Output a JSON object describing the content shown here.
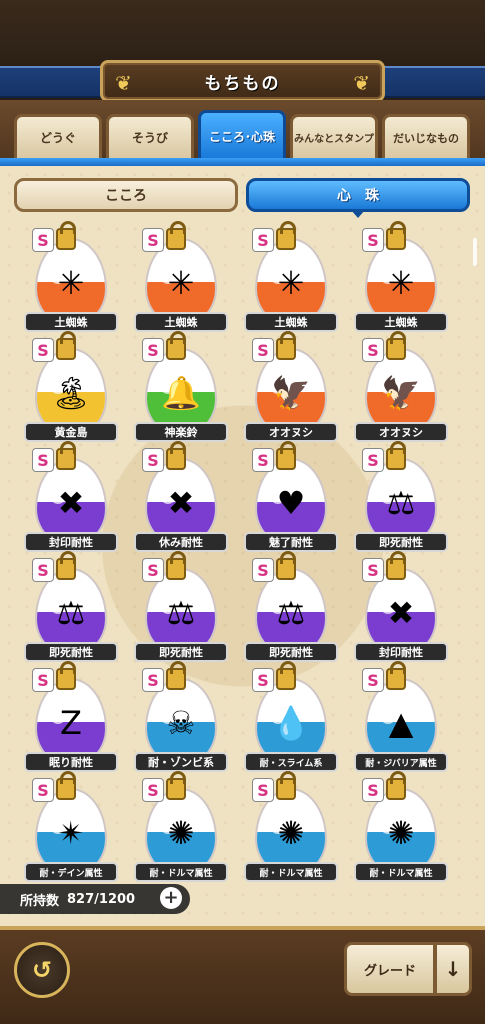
{
  "header": {
    "title": "もちもの"
  },
  "tabs": [
    {
      "label": "どうぐ",
      "active": false
    },
    {
      "label": "そうび",
      "active": false
    },
    {
      "label": "こころ･心珠",
      "active": true
    },
    {
      "label": "みんなとスタンプ",
      "active": false
    },
    {
      "label": "だいじなもの",
      "active": false
    }
  ],
  "segment": {
    "left": "こころ",
    "right": "心　珠"
  },
  "items": [
    {
      "label": "土蜘蛛",
      "color": "#f06a2a",
      "icon": "spider-web-icon",
      "glyph": "✳"
    },
    {
      "label": "土蜘蛛",
      "color": "#f06a2a",
      "icon": "spider-web-icon",
      "glyph": "✳"
    },
    {
      "label": "土蜘蛛",
      "color": "#f06a2a",
      "icon": "spider-web-icon",
      "glyph": "✳"
    },
    {
      "label": "土蜘蛛",
      "color": "#f06a2a",
      "icon": "spider-web-icon",
      "glyph": "✳"
    },
    {
      "label": "黄金島",
      "color": "#f2c230",
      "icon": "casino-island-icon",
      "glyph": "🏝"
    },
    {
      "label": "神楽鈴",
      "color": "#4fbf3a",
      "icon": "bell-icon",
      "glyph": "🔔"
    },
    {
      "label": "オオヌシ",
      "color": "#f06a2a",
      "icon": "eagle-icon",
      "glyph": "🦅"
    },
    {
      "label": "オオヌシ",
      "color": "#f06a2a",
      "icon": "eagle-icon",
      "glyph": "🦅"
    },
    {
      "label": "封印耐性",
      "color": "#7a3dcf",
      "icon": "seal-face-icon",
      "glyph": "✖"
    },
    {
      "label": "休み耐性",
      "color": "#7a3dcf",
      "icon": "red-cross-icon",
      "glyph": "✖"
    },
    {
      "label": "魅了耐性",
      "color": "#7a3dcf",
      "icon": "hearts-icon",
      "glyph": "♥"
    },
    {
      "label": "即死耐性",
      "color": "#7a3dcf",
      "icon": "death-glyph-icon",
      "glyph": "⚖"
    },
    {
      "label": "即死耐性",
      "color": "#7a3dcf",
      "icon": "death-glyph-icon",
      "glyph": "⚖"
    },
    {
      "label": "即死耐性",
      "color": "#7a3dcf",
      "icon": "death-glyph-icon",
      "glyph": "⚖"
    },
    {
      "label": "即死耐性",
      "color": "#7a3dcf",
      "icon": "death-glyph-icon",
      "glyph": "⚖"
    },
    {
      "label": "封印耐性",
      "color": "#7a3dcf",
      "icon": "seal-face-icon",
      "glyph": "✖"
    },
    {
      "label": "眠り耐性",
      "color": "#7a3dcf",
      "icon": "sleep-zzz-icon",
      "glyph": "Z"
    },
    {
      "label": "耐・ゾンビ系",
      "color": "#2d9bd6",
      "icon": "skull-icon",
      "glyph": "☠"
    },
    {
      "label": "耐・スライム系",
      "color": "#2d9bd6",
      "icon": "slime-icon",
      "glyph": "💧"
    },
    {
      "label": "耐・ジバリア属性",
      "color": "#2d9bd6",
      "icon": "rock-spikes-icon",
      "glyph": "▲"
    },
    {
      "label": "耐・デイン属性",
      "color": "#2d9bd6",
      "icon": "lightning-star-icon",
      "glyph": "✴"
    },
    {
      "label": "耐・ドルマ属性",
      "color": "#2d9bd6",
      "icon": "dark-vortex-icon",
      "glyph": "✺"
    },
    {
      "label": "耐・ドルマ属性",
      "color": "#2d9bd6",
      "icon": "dark-vortex-icon",
      "glyph": "✺"
    },
    {
      "label": "耐・ドルマ属性",
      "color": "#2d9bd6",
      "icon": "dark-vortex-icon",
      "glyph": "✺"
    }
  ],
  "count": {
    "label": "所持数",
    "value": "827/1200"
  },
  "footer": {
    "grade_label": "グレード",
    "sort_glyph": "↓",
    "back_glyph": "↺"
  }
}
